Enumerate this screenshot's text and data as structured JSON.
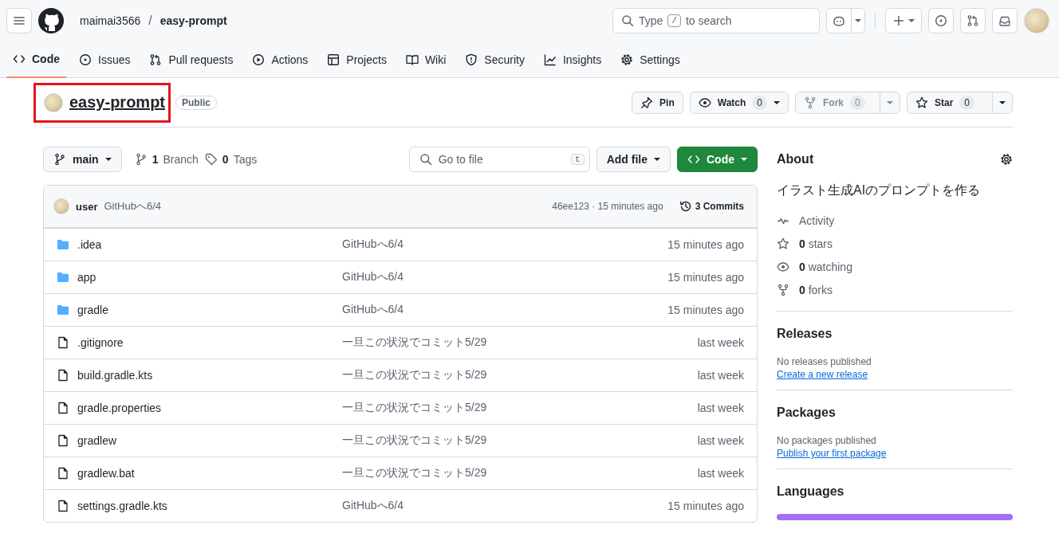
{
  "header": {
    "owner": "maimai3566",
    "separator": "/",
    "repo": "easy-prompt",
    "search_before": "Type",
    "search_key": "/",
    "search_after": "to search"
  },
  "tabs": [
    {
      "label": "Code",
      "selected": true
    },
    {
      "label": "Issues",
      "selected": false
    },
    {
      "label": "Pull requests",
      "selected": false
    },
    {
      "label": "Actions",
      "selected": false
    },
    {
      "label": "Projects",
      "selected": false
    },
    {
      "label": "Wiki",
      "selected": false
    },
    {
      "label": "Security",
      "selected": false
    },
    {
      "label": "Insights",
      "selected": false
    },
    {
      "label": "Settings",
      "selected": false
    }
  ],
  "repo": {
    "name": "easy-prompt",
    "highlighted": true,
    "visibility": "Public",
    "actions": [
      {
        "kind": "pin",
        "label": "Pin",
        "disabled": false
      },
      {
        "kind": "watch",
        "label": "Watch",
        "count": "0",
        "disabled": false
      },
      {
        "kind": "fork",
        "label": "Fork",
        "count": "0",
        "disabled": true
      },
      {
        "kind": "star",
        "label": "Star",
        "count": "0",
        "disabled": false
      }
    ]
  },
  "toolbar": {
    "branch": "main",
    "branches_count": "1",
    "branches_label": "Branch",
    "tags_count": "0",
    "tags_label": "Tags",
    "file_search_placeholder": "Go to file",
    "file_search_key": "t",
    "add_file": "Add file",
    "code": "Code"
  },
  "latest_commit": {
    "author": "user",
    "message": "GitHubへ6/4",
    "sha_time": "46ee123 · 15 minutes ago",
    "commits_count": "3",
    "commits_label": "Commits"
  },
  "files": [
    {
      "kind": "folder",
      "name": ".idea",
      "message": "GitHubへ6/4",
      "time": "15 minutes ago"
    },
    {
      "kind": "folder",
      "name": "app",
      "message": "GitHubへ6/4",
      "time": "15 minutes ago"
    },
    {
      "kind": "folder",
      "name": "gradle",
      "message": "GitHubへ6/4",
      "time": "15 minutes ago"
    },
    {
      "kind": "file",
      "name": ".gitignore",
      "message": "一旦この状況でコミット5/29",
      "time": "last week"
    },
    {
      "kind": "file",
      "name": "build.gradle.kts",
      "message": "一旦この状況でコミット5/29",
      "time": "last week"
    },
    {
      "kind": "file",
      "name": "gradle.properties",
      "message": "一旦この状況でコミット5/29",
      "time": "last week"
    },
    {
      "kind": "file",
      "name": "gradlew",
      "message": "一旦この状況でコミット5/29",
      "time": "last week"
    },
    {
      "kind": "file",
      "name": "gradlew.bat",
      "message": "一旦この状況でコミット5/29",
      "time": "last week"
    },
    {
      "kind": "file",
      "name": "settings.gradle.kts",
      "message": "GitHubへ6/4",
      "time": "15 minutes ago"
    }
  ],
  "about": {
    "title": "About",
    "description": "イラスト生成AIのプロンプトを作る",
    "stats": [
      {
        "kind": "activity",
        "text": "Activity"
      },
      {
        "kind": "stars",
        "count": "0",
        "text": "stars"
      },
      {
        "kind": "watching",
        "count": "0",
        "text": "watching"
      },
      {
        "kind": "forks",
        "count": "0",
        "text": "forks"
      }
    ]
  },
  "releases": {
    "title": "Releases",
    "note": "No releases published",
    "link": "Create a new release"
  },
  "packages": {
    "title": "Packages",
    "note": "No packages published",
    "link": "Publish your first package"
  },
  "languages": {
    "title": "Languages"
  }
}
